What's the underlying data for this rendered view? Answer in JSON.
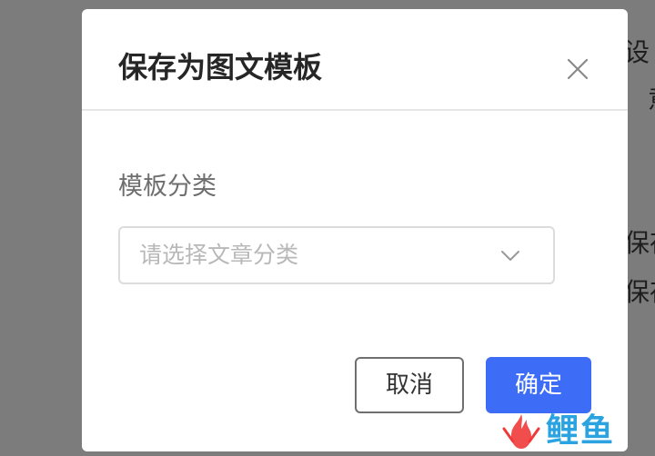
{
  "background": {
    "text_lines": [
      "设",
      "意",
      "保存",
      "保存"
    ]
  },
  "dialog": {
    "title": "保存为图文模板",
    "close_icon": "close-icon",
    "field_label": "模板分类",
    "select": {
      "placeholder": "请选择文章分类",
      "icon": "chevron-down-icon"
    },
    "cancel_label": "取消",
    "confirm_label": "确定"
  },
  "watermark": {
    "text": "鲤鱼",
    "colors": [
      "#f03a3a",
      "#2aa3e0",
      "#27b36b"
    ]
  },
  "colors": {
    "primary": "#3d6df6",
    "overlay": "#7c7c7c"
  }
}
